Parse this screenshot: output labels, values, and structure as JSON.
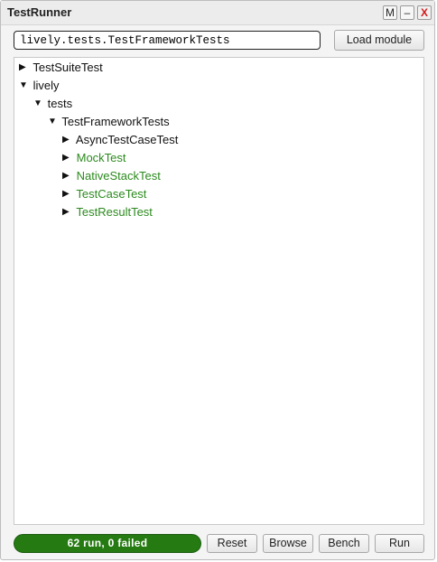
{
  "window": {
    "title": "TestRunner",
    "buttons": {
      "menu": "M",
      "minimize": "–",
      "close": "X"
    }
  },
  "module": {
    "input_value": "lively.tests.TestFrameworkTests",
    "load_label": "Load module"
  },
  "tree": {
    "nodes": [
      {
        "label": "TestSuiteTest",
        "expanded": false,
        "status": "passed"
      },
      {
        "label": "lively",
        "expanded": true,
        "status": "none"
      },
      {
        "label": "tests",
        "expanded": true,
        "status": "none"
      },
      {
        "label": "TestFrameworkTests",
        "expanded": true,
        "status": "none"
      },
      {
        "label": "AsyncTestCaseTest",
        "expanded": false,
        "status": "none"
      },
      {
        "label": "MockTest",
        "expanded": false,
        "status": "passed"
      },
      {
        "label": "NativeStackTest",
        "expanded": false,
        "status": "passed"
      },
      {
        "label": "TestCaseTest",
        "expanded": false,
        "status": "passed"
      },
      {
        "label": "TestResultTest",
        "expanded": false,
        "status": "passed"
      }
    ],
    "arrow_collapsed": "▶",
    "arrow_expanded": "▼"
  },
  "status": {
    "text": "62 run, 0 failed",
    "color": "#257a12"
  },
  "toolbar": {
    "reset_label": "Reset",
    "browse_label": "Browse",
    "bench_label": "Bench",
    "run_label": "Run"
  },
  "colors": {
    "passed_text": "#2b8a1d",
    "close_x": "#d21b1b"
  }
}
